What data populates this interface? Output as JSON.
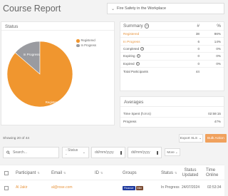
{
  "page": {
    "title": "Course Report"
  },
  "course_select": {
    "value": "Fire Safety in the Workplace"
  },
  "status_card": {
    "title": "Status",
    "legend": [
      {
        "label": "Registered",
        "color": "#f0962f"
      },
      {
        "label": "In Progress",
        "color": "#9a9ba0"
      }
    ]
  },
  "chart_data": {
    "type": "pie",
    "labels": [
      "Registered",
      "In Progress"
    ],
    "values": [
      38,
      6
    ],
    "colors": [
      "#f0962f",
      "#9a9ba0"
    ]
  },
  "summary": {
    "title": "Summary",
    "count_header": "#",
    "percent_header": "%",
    "rows": [
      {
        "label": "Registered",
        "count": "38",
        "percent": "86%"
      },
      {
        "label": "In Progress",
        "count": "6",
        "percent": "14%"
      },
      {
        "label": "Completed",
        "count": "0",
        "percent": "0%"
      },
      {
        "label": "Expiring",
        "count": "0",
        "percent": "0%"
      },
      {
        "label": "Expired",
        "count": "0",
        "percent": "0%"
      }
    ],
    "total": {
      "label": "Total Participants",
      "count": "44"
    }
  },
  "averages": {
    "title": "Averages",
    "time_spent": {
      "label": "Time Spent (h:m:s)",
      "value": "02:59:15"
    },
    "progress": {
      "label": "Progress",
      "value": "47%"
    }
  },
  "list": {
    "showing": "Showing 20 of 44",
    "export_label": "Export XLS",
    "bulk_label": "Bulk Action"
  },
  "filters": {
    "search_placeholder": "Search...",
    "status_value": "- Status -",
    "date_from_placeholder": "dd/mm/yyyy",
    "date_to_placeholder": "dd/mm/yyyy",
    "more_label": "More"
  },
  "table": {
    "headers": {
      "participant": "Participant",
      "email": "Email",
      "id": "ID",
      "groups": "Groups",
      "status": "Status",
      "status_updated": "Status Updated",
      "time_online": "Time Online"
    },
    "rows": [
      {
        "participant": "Al Jakir",
        "email": "al@rose.com",
        "id": "",
        "groups": [
          {
            "label": "Finance",
            "color": "#1f3a9e"
          },
          {
            "label": "Mkt",
            "color": "#7a4a32"
          }
        ],
        "status": "In Progress",
        "status_updated": "24/07/2024",
        "time_online": "02:53:34"
      }
    ]
  }
}
